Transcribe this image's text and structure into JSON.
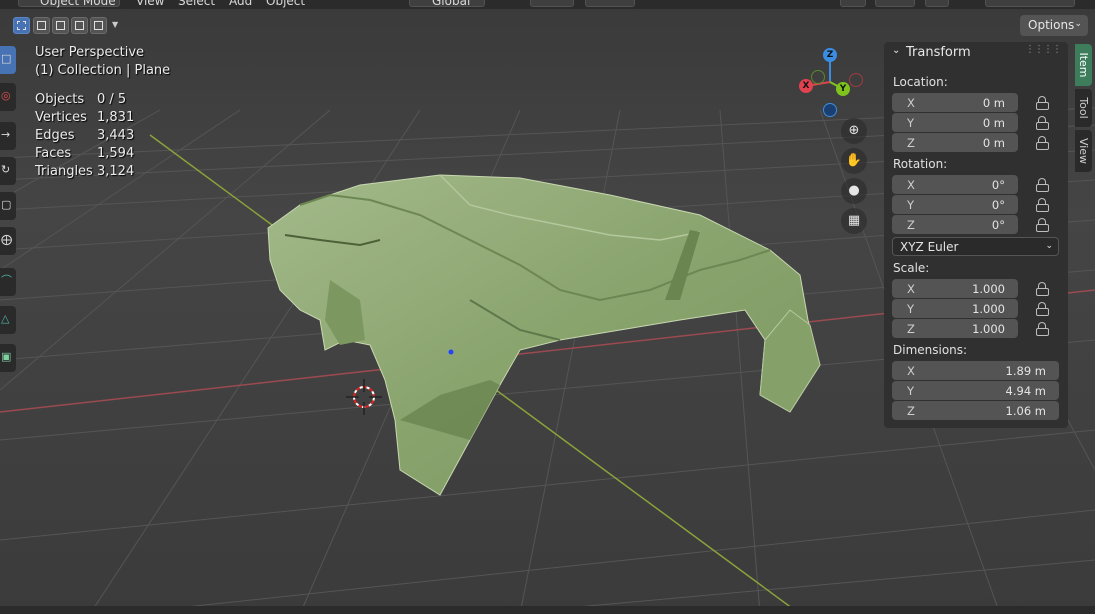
{
  "header": {
    "mode": "Object Mode",
    "menus": [
      "View",
      "Select",
      "Add",
      "Object"
    ],
    "orientation": "Global"
  },
  "toolbar": {
    "options_label": "Options"
  },
  "overlay": {
    "view_name": "User Perspective",
    "collection": "(1) Collection | Plane"
  },
  "stats": {
    "objects_label": "Objects",
    "objects_value": "0 / 5",
    "vertices_label": "Vertices",
    "vertices_value": "1,831",
    "edges_label": "Edges",
    "edges_value": "3,443",
    "faces_label": "Faces",
    "faces_value": "1,594",
    "triangles_label": "Triangles",
    "triangles_value": "3,124"
  },
  "gizmo": {
    "x_label": "X",
    "y_label": "Y",
    "z_label": "Z",
    "x_color": "#e0424f",
    "y_color": "#7fc41e",
    "z_color": "#3b8de3"
  },
  "transform": {
    "title": "Transform",
    "location_label": "Location:",
    "location": [
      {
        "axis": "X",
        "value": "0 m"
      },
      {
        "axis": "Y",
        "value": "0 m"
      },
      {
        "axis": "Z",
        "value": "0 m"
      }
    ],
    "rotation_label": "Rotation:",
    "rotation": [
      {
        "axis": "X",
        "value": "0°"
      },
      {
        "axis": "Y",
        "value": "0°"
      },
      {
        "axis": "Z",
        "value": "0°"
      }
    ],
    "rotation_mode": "XYZ Euler",
    "scale_label": "Scale:",
    "scale": [
      {
        "axis": "X",
        "value": "1.000"
      },
      {
        "axis": "Y",
        "value": "1.000"
      },
      {
        "axis": "Z",
        "value": "1.000"
      }
    ],
    "dimensions_label": "Dimensions:",
    "dimensions": [
      {
        "axis": "X",
        "value": "1.89 m"
      },
      {
        "axis": "Y",
        "value": "4.94 m"
      },
      {
        "axis": "Z",
        "value": "1.06 m"
      }
    ]
  },
  "side_tabs": [
    "Item",
    "Tool",
    "View"
  ],
  "colors": {
    "accent": "#4772b3",
    "item_tab": "#3d7d5c",
    "mesh": "#8fa873"
  }
}
